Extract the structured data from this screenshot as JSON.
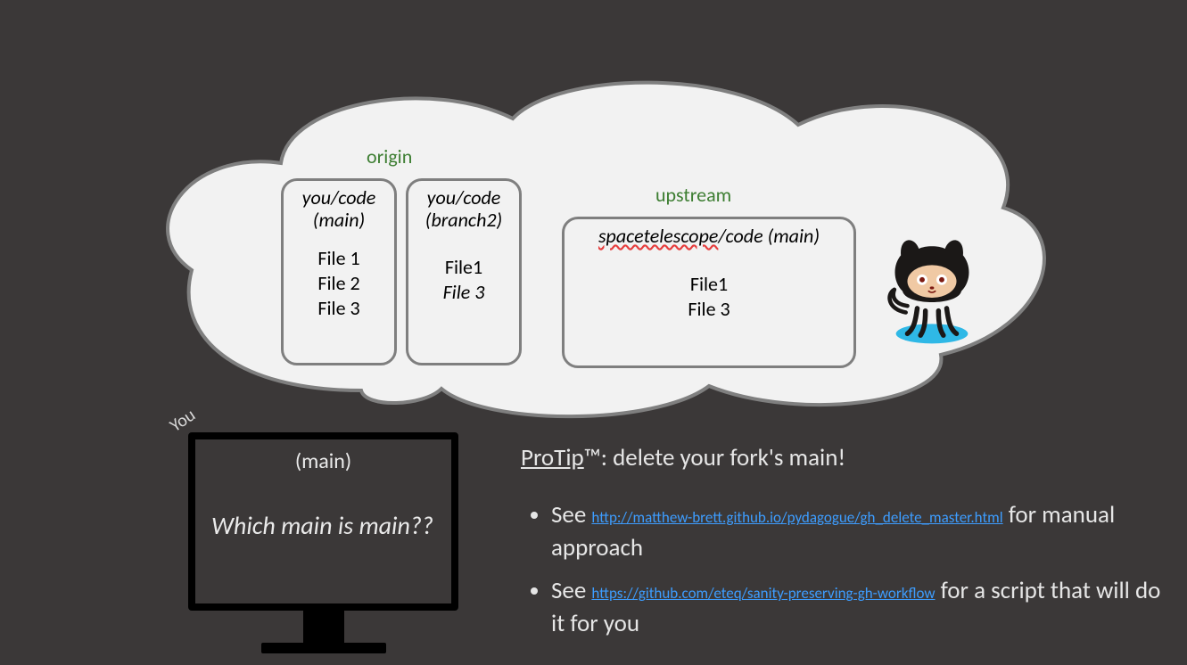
{
  "cloud": {
    "origin_label": "origin",
    "upstream_label": "upstream",
    "box1": {
      "title_line1": "you/code",
      "title_line2": "(main)",
      "files": [
        "File 1",
        "File 2",
        "File 3"
      ]
    },
    "box2": {
      "title_line1": "you/code",
      "title_line2": "(branch2)",
      "files": [
        "File1",
        "File 3"
      ],
      "italic_indices": [
        1
      ]
    },
    "box3": {
      "title_repo": "spacetelescope",
      "title_rest": "/code (main)",
      "files": [
        "File1",
        "File 3"
      ]
    }
  },
  "monitor": {
    "you_label": "You",
    "main_label": "(main)",
    "question": "Which main is main??"
  },
  "protip": {
    "head_underlined": "ProTip",
    "head_rest": "™: delete your fork's main!",
    "bullet1_see": "See ",
    "bullet1_link": "http://matthew-brett.github.io/pydagogue/gh_delete_master.html",
    "bullet1_rest": " for manual approach",
    "bullet2_see": "See ",
    "bullet2_link": "https://github.com/eteq/sanity-preserving-gh-workflow",
    "bullet2_rest": " for a script that will do it for you"
  }
}
